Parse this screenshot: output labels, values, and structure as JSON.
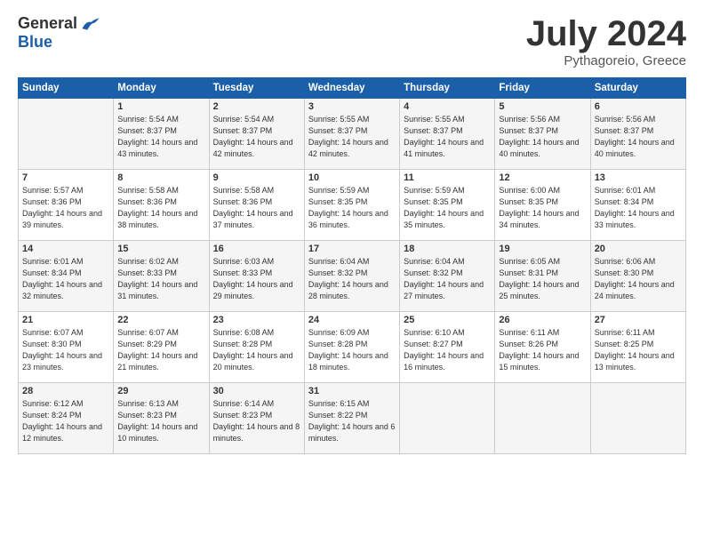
{
  "header": {
    "logo_general": "General",
    "logo_blue": "Blue",
    "month_title": "July 2024",
    "location": "Pythagoreio, Greece"
  },
  "days_of_week": [
    "Sunday",
    "Monday",
    "Tuesday",
    "Wednesday",
    "Thursday",
    "Friday",
    "Saturday"
  ],
  "weeks": [
    [
      {
        "day": "",
        "sunrise": "",
        "sunset": "",
        "daylight": ""
      },
      {
        "day": "1",
        "sunrise": "Sunrise: 5:54 AM",
        "sunset": "Sunset: 8:37 PM",
        "daylight": "Daylight: 14 hours and 43 minutes."
      },
      {
        "day": "2",
        "sunrise": "Sunrise: 5:54 AM",
        "sunset": "Sunset: 8:37 PM",
        "daylight": "Daylight: 14 hours and 42 minutes."
      },
      {
        "day": "3",
        "sunrise": "Sunrise: 5:55 AM",
        "sunset": "Sunset: 8:37 PM",
        "daylight": "Daylight: 14 hours and 42 minutes."
      },
      {
        "day": "4",
        "sunrise": "Sunrise: 5:55 AM",
        "sunset": "Sunset: 8:37 PM",
        "daylight": "Daylight: 14 hours and 41 minutes."
      },
      {
        "day": "5",
        "sunrise": "Sunrise: 5:56 AM",
        "sunset": "Sunset: 8:37 PM",
        "daylight": "Daylight: 14 hours and 40 minutes."
      },
      {
        "day": "6",
        "sunrise": "Sunrise: 5:56 AM",
        "sunset": "Sunset: 8:37 PM",
        "daylight": "Daylight: 14 hours and 40 minutes."
      }
    ],
    [
      {
        "day": "7",
        "sunrise": "Sunrise: 5:57 AM",
        "sunset": "Sunset: 8:36 PM",
        "daylight": "Daylight: 14 hours and 39 minutes."
      },
      {
        "day": "8",
        "sunrise": "Sunrise: 5:58 AM",
        "sunset": "Sunset: 8:36 PM",
        "daylight": "Daylight: 14 hours and 38 minutes."
      },
      {
        "day": "9",
        "sunrise": "Sunrise: 5:58 AM",
        "sunset": "Sunset: 8:36 PM",
        "daylight": "Daylight: 14 hours and 37 minutes."
      },
      {
        "day": "10",
        "sunrise": "Sunrise: 5:59 AM",
        "sunset": "Sunset: 8:35 PM",
        "daylight": "Daylight: 14 hours and 36 minutes."
      },
      {
        "day": "11",
        "sunrise": "Sunrise: 5:59 AM",
        "sunset": "Sunset: 8:35 PM",
        "daylight": "Daylight: 14 hours and 35 minutes."
      },
      {
        "day": "12",
        "sunrise": "Sunrise: 6:00 AM",
        "sunset": "Sunset: 8:35 PM",
        "daylight": "Daylight: 14 hours and 34 minutes."
      },
      {
        "day": "13",
        "sunrise": "Sunrise: 6:01 AM",
        "sunset": "Sunset: 8:34 PM",
        "daylight": "Daylight: 14 hours and 33 minutes."
      }
    ],
    [
      {
        "day": "14",
        "sunrise": "Sunrise: 6:01 AM",
        "sunset": "Sunset: 8:34 PM",
        "daylight": "Daylight: 14 hours and 32 minutes."
      },
      {
        "day": "15",
        "sunrise": "Sunrise: 6:02 AM",
        "sunset": "Sunset: 8:33 PM",
        "daylight": "Daylight: 14 hours and 31 minutes."
      },
      {
        "day": "16",
        "sunrise": "Sunrise: 6:03 AM",
        "sunset": "Sunset: 8:33 PM",
        "daylight": "Daylight: 14 hours and 29 minutes."
      },
      {
        "day": "17",
        "sunrise": "Sunrise: 6:04 AM",
        "sunset": "Sunset: 8:32 PM",
        "daylight": "Daylight: 14 hours and 28 minutes."
      },
      {
        "day": "18",
        "sunrise": "Sunrise: 6:04 AM",
        "sunset": "Sunset: 8:32 PM",
        "daylight": "Daylight: 14 hours and 27 minutes."
      },
      {
        "day": "19",
        "sunrise": "Sunrise: 6:05 AM",
        "sunset": "Sunset: 8:31 PM",
        "daylight": "Daylight: 14 hours and 25 minutes."
      },
      {
        "day": "20",
        "sunrise": "Sunrise: 6:06 AM",
        "sunset": "Sunset: 8:30 PM",
        "daylight": "Daylight: 14 hours and 24 minutes."
      }
    ],
    [
      {
        "day": "21",
        "sunrise": "Sunrise: 6:07 AM",
        "sunset": "Sunset: 8:30 PM",
        "daylight": "Daylight: 14 hours and 23 minutes."
      },
      {
        "day": "22",
        "sunrise": "Sunrise: 6:07 AM",
        "sunset": "Sunset: 8:29 PM",
        "daylight": "Daylight: 14 hours and 21 minutes."
      },
      {
        "day": "23",
        "sunrise": "Sunrise: 6:08 AM",
        "sunset": "Sunset: 8:28 PM",
        "daylight": "Daylight: 14 hours and 20 minutes."
      },
      {
        "day": "24",
        "sunrise": "Sunrise: 6:09 AM",
        "sunset": "Sunset: 8:28 PM",
        "daylight": "Daylight: 14 hours and 18 minutes."
      },
      {
        "day": "25",
        "sunrise": "Sunrise: 6:10 AM",
        "sunset": "Sunset: 8:27 PM",
        "daylight": "Daylight: 14 hours and 16 minutes."
      },
      {
        "day": "26",
        "sunrise": "Sunrise: 6:11 AM",
        "sunset": "Sunset: 8:26 PM",
        "daylight": "Daylight: 14 hours and 15 minutes."
      },
      {
        "day": "27",
        "sunrise": "Sunrise: 6:11 AM",
        "sunset": "Sunset: 8:25 PM",
        "daylight": "Daylight: 14 hours and 13 minutes."
      }
    ],
    [
      {
        "day": "28",
        "sunrise": "Sunrise: 6:12 AM",
        "sunset": "Sunset: 8:24 PM",
        "daylight": "Daylight: 14 hours and 12 minutes."
      },
      {
        "day": "29",
        "sunrise": "Sunrise: 6:13 AM",
        "sunset": "Sunset: 8:23 PM",
        "daylight": "Daylight: 14 hours and 10 minutes."
      },
      {
        "day": "30",
        "sunrise": "Sunrise: 6:14 AM",
        "sunset": "Sunset: 8:23 PM",
        "daylight": "Daylight: 14 hours and 8 minutes."
      },
      {
        "day": "31",
        "sunrise": "Sunrise: 6:15 AM",
        "sunset": "Sunset: 8:22 PM",
        "daylight": "Daylight: 14 hours and 6 minutes."
      },
      {
        "day": "",
        "sunrise": "",
        "sunset": "",
        "daylight": ""
      },
      {
        "day": "",
        "sunrise": "",
        "sunset": "",
        "daylight": ""
      },
      {
        "day": "",
        "sunrise": "",
        "sunset": "",
        "daylight": ""
      }
    ]
  ]
}
